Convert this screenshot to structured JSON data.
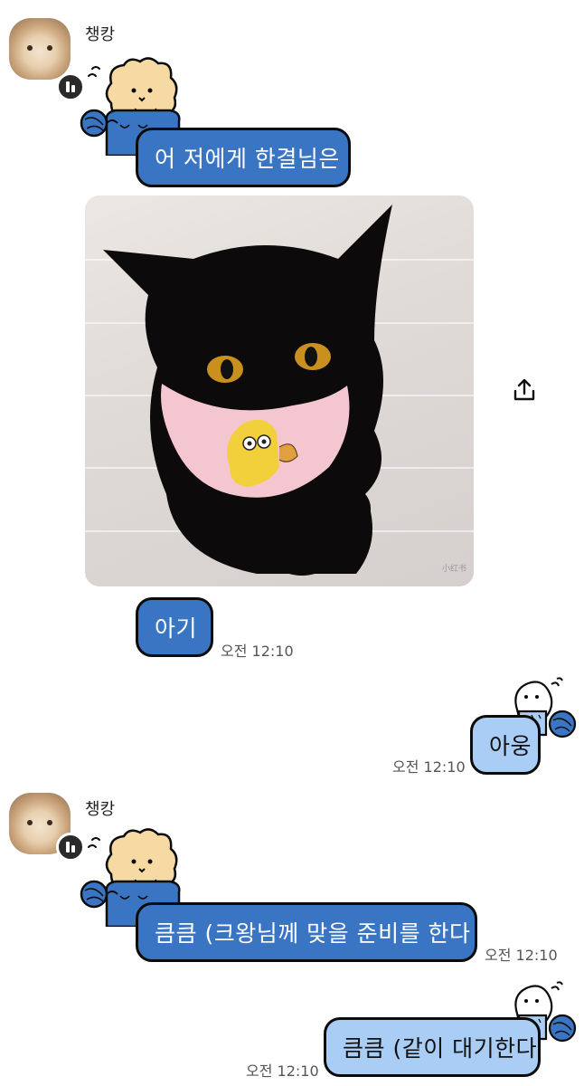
{
  "conversation": {
    "messages": [
      {
        "sender": "챙캉",
        "text": "어 저에게 한결님은"
      },
      {
        "text": "아기",
        "time": "오전 12:10"
      },
      {
        "text": "아웅",
        "time": "오전 12:10"
      },
      {
        "sender": "챙캉",
        "text": "큼큼 (크왕님께 맞을 준비를 한다",
        "time": "오전 12:10"
      },
      {
        "text": "큼큼 (같이 대기한다",
        "time": "오전 12:10"
      }
    ],
    "photo": {
      "watermark": "小红书"
    }
  },
  "icons": {
    "share": "share-icon",
    "avatar_badge": "chat-badge-icon",
    "sticker_in": "bear-knitting-sticker",
    "sticker_out": "ghost-knitting-sticker"
  },
  "colors": {
    "incoming_bubble": "#3a75c4",
    "outgoing_bubble": "#a9cdf4",
    "outline": "#0b0b0b",
    "sticker_bear": "#f6d9a3",
    "yarn": "#3a75c4"
  }
}
